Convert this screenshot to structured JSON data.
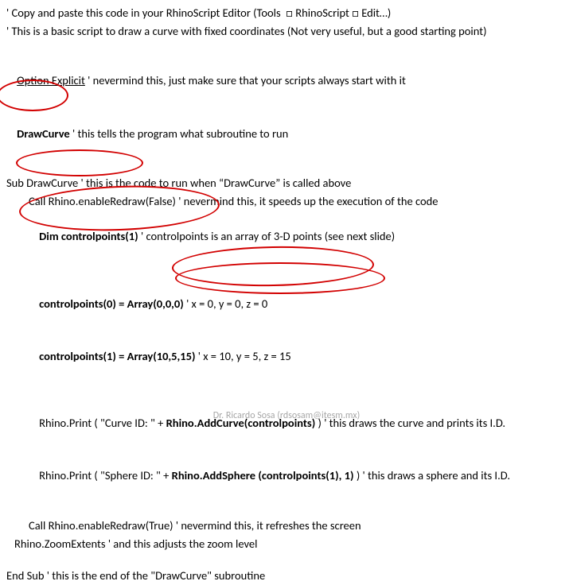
{
  "l1": "' Copy and paste this code in your RhinoScript Editor (Tools  □ RhinoScript □ Edit…)",
  "l2": "' This is a basic script to draw a curve with fixed coordinates (Not very useful, but a good starting point)",
  "l3a": "Option Explicit",
  "l3b": " ' nevermind this, just make sure that your scripts always start with it",
  "l4a": "DrawCurve ",
  "l4b": "' this tells the program what subroutine to run",
  "l5": "Sub DrawCurve ' this is the code to run when “DrawCurve” is called above",
  "l6": "Call Rhino.enableRedraw(False) ' nevermind this, it speeds up the execution of the code",
  "l7a": "Dim controlpoints(1) ",
  "l7b": "' controlpoints is an array of 3-D points (see next slide)",
  "l8a": "controlpoints(0) = Array(0,0,0) ",
  "l8b": "' x = 0, y = 0, z = 0",
  "l9a": "controlpoints(1) = Array(10,5,15) ",
  "l9b": "' x = 10, y = 5, z = 15",
  "l10a": "Rhino.Print ( \"Curve ID: \" + ",
  "l10b": "Rhino.AddCurve(controlpoints) ",
  "l10c": ") ' this draws the curve and prints its I.D.",
  "l11a": "Rhino.Print ( \"Sphere ID: \" + ",
  "l11b": "Rhino.AddSphere (controlpoints(1), 1) ",
  "l11c": ") ' this draws a sphere and its I.D.",
  "l12": "Call Rhino.enableRedraw(True) ' nevermind this, it refreshes the screen",
  "l13": "Rhino.ZoomExtents ' and this adjusts the zoom level",
  "l14": "End Sub ' this is the end of the \"DrawCurve\" subroutine",
  "footer": "Dr. Ricardo Sosa (rdsosam@itesm.mx)"
}
